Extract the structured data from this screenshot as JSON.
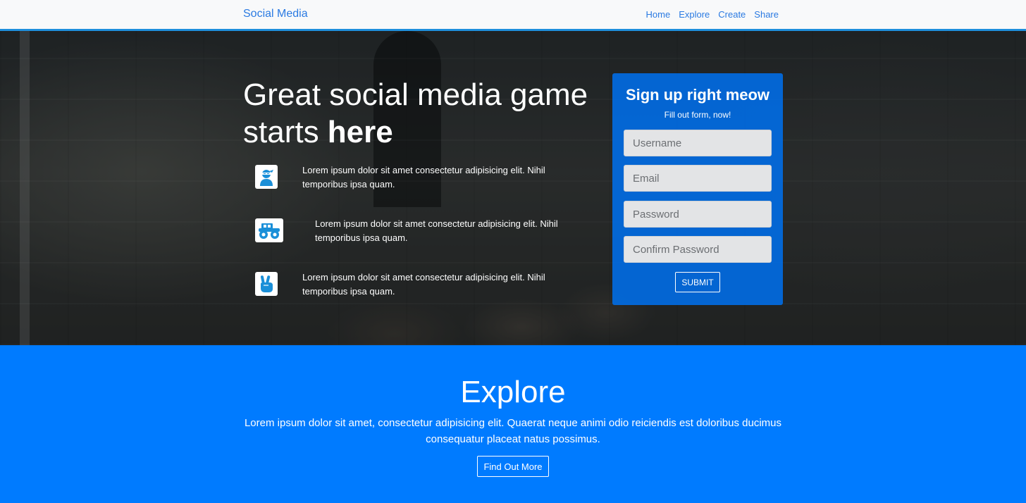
{
  "navbar": {
    "brand": "Social Media",
    "links": [
      "Home",
      "Explore",
      "Create",
      "Share"
    ]
  },
  "hero": {
    "title_line1": "Great social media game",
    "title_line2_prefix": "starts ",
    "title_line2_bold": "here",
    "features": [
      {
        "icon": "ninja-icon",
        "text": "Lorem ipsum dolor sit amet consectetur adipisicing elit. Nihil temporibus ipsa quam."
      },
      {
        "icon": "truck-icon",
        "text": "Lorem ipsum dolor sit amet consectetur adipisicing elit. Nihil temporibus ipsa quam."
      },
      {
        "icon": "peace-hand-icon",
        "text": "Lorem ipsum dolor sit amet consectetur adipisicing elit. Nihil temporibus ipsa quam."
      }
    ]
  },
  "signup": {
    "title": "Sign up right meow",
    "subtitle": "Fill out form, now!",
    "username_placeholder": "Username",
    "email_placeholder": "Email",
    "password_placeholder": "Password",
    "confirm_placeholder": "Confirm Password",
    "submit_label": "SUBMIT"
  },
  "explore": {
    "title": "Explore",
    "text": "Lorem ipsum dolor sit amet, consectetur adipisicing elit. Quaerat neque animi odio reiciendis est doloribus ducimus consequatur placeat natus possimus.",
    "button_label": "Find Out More"
  },
  "colors": {
    "nav_bg": "#f8f9fa",
    "nav_link": "#2a7ae2",
    "accent": "#007bff",
    "icon_blue": "#1a8fd8"
  }
}
